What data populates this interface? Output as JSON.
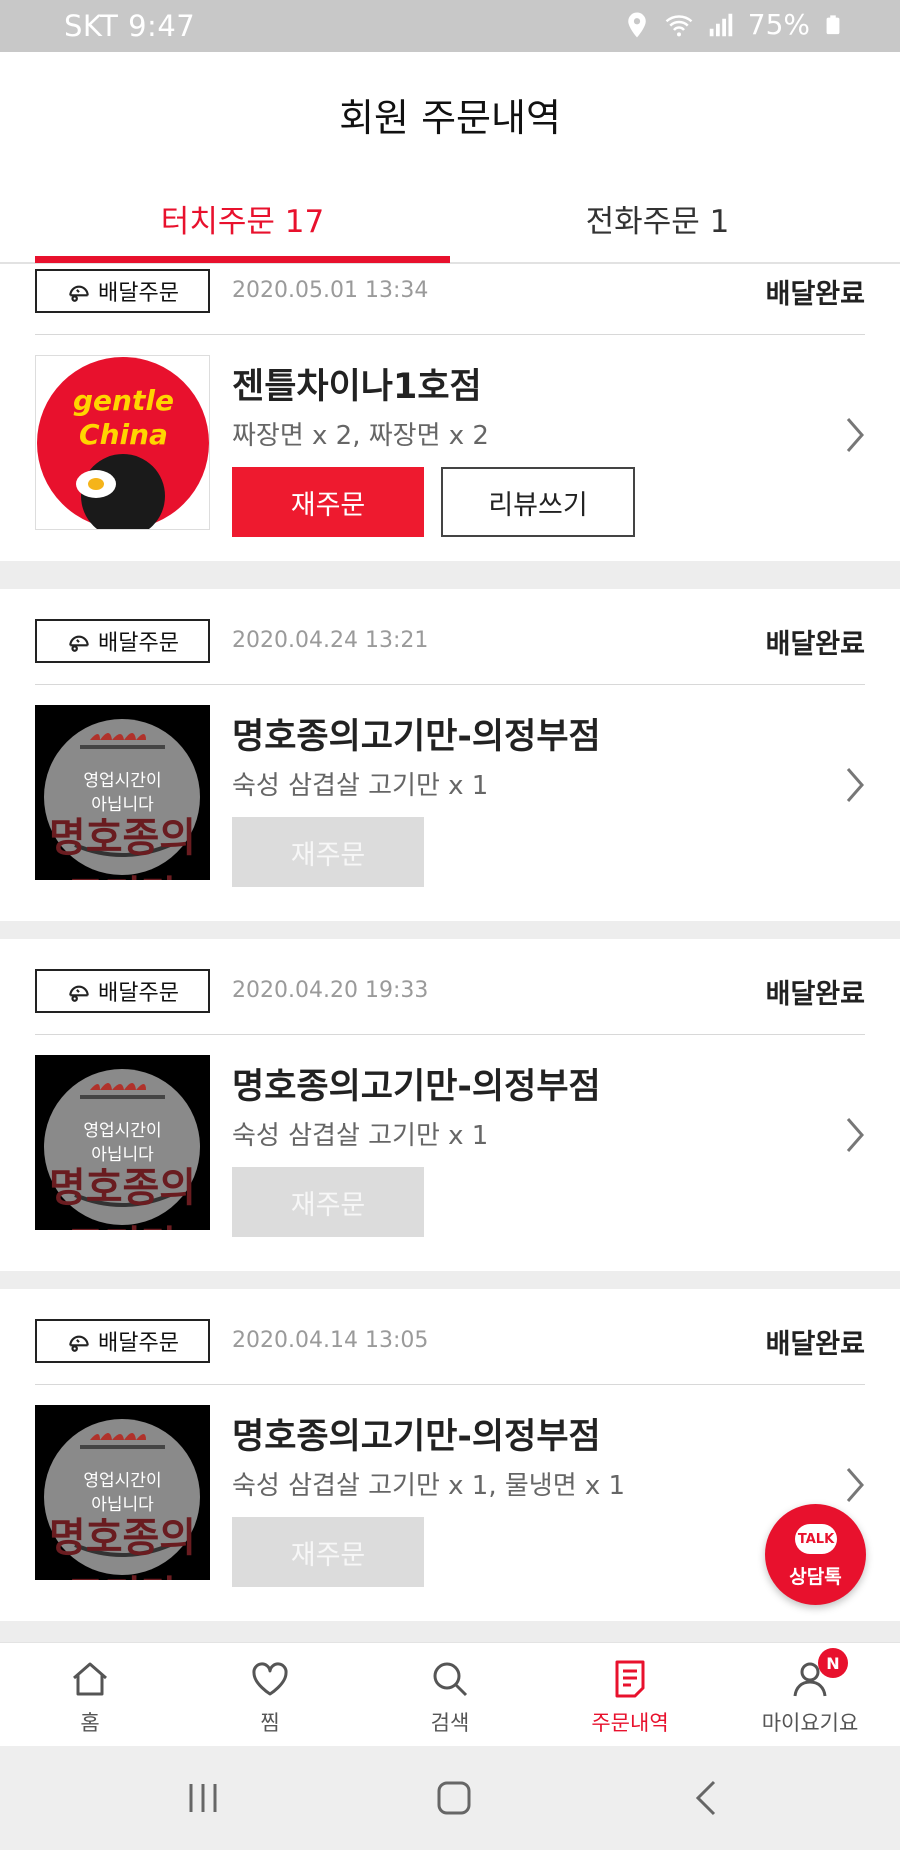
{
  "status_bar": {
    "carrier_time": "SKT 9:47",
    "battery": "75%"
  },
  "header": {
    "title": "회원 주문내역"
  },
  "tabs": [
    {
      "label": "터치주문 17",
      "active": true
    },
    {
      "label": "전화주문 1",
      "active": false
    }
  ],
  "orders": [
    {
      "badge": "배달주문",
      "date": "2020.05.01 13:34",
      "status": "배달완료",
      "store": "젠틀차이나1호점",
      "items": "짜장면 x 2, 짜장면 x 2",
      "reorder_label": "재주문",
      "review_label": "리뷰쓰기",
      "thumb_text": "gentle China",
      "thumb_icon": "gentle-china-logo"
    },
    {
      "badge": "배달주문",
      "date": "2020.04.24 13:21",
      "status": "배달완료",
      "store": "명호종의고기만-의정부점",
      "items": "숙성 삼겹살 고기만 x 1",
      "reorder_label": "재주문",
      "closed_text": "영업시간이\n아닙니다",
      "thumb_text": "명호종의 고기만",
      "thumb_icon": "meat-store-logo"
    },
    {
      "badge": "배달주문",
      "date": "2020.04.20 19:33",
      "status": "배달완료",
      "store": "명호종의고기만-의정부점",
      "items": "숙성 삼겹살 고기만 x 1",
      "reorder_label": "재주문",
      "closed_text": "영업시간이\n아닙니다",
      "thumb_text": "명호종의 고기만",
      "thumb_icon": "meat-store-logo"
    },
    {
      "badge": "배달주문",
      "date": "2020.04.14 13:05",
      "status": "배달완료",
      "store": "명호종의고기만-의정부점",
      "items": "숙성 삼겹살 고기만 x 1, 물냉면 x 1",
      "reorder_label": "재주문",
      "closed_text": "영업시간이\n아닙니다",
      "thumb_text": "명호종의 고기만",
      "thumb_icon": "meat-store-logo"
    }
  ],
  "talk_button": {
    "bubble": "TALK",
    "label": "상담톡"
  },
  "bottom_nav": [
    {
      "label": "홈",
      "icon": "home-icon",
      "active": false
    },
    {
      "label": "찜",
      "icon": "heart-icon",
      "active": false
    },
    {
      "label": "검색",
      "icon": "search-icon",
      "active": false
    },
    {
      "label": "주문내역",
      "icon": "order-list-icon",
      "active": true
    },
    {
      "label": "마이요기요",
      "icon": "user-icon",
      "active": false,
      "badge": "N"
    }
  ],
  "colors": {
    "accent": "#e8112d",
    "disabled": "#dcdcdc",
    "status_bar": "#c8c8c8"
  }
}
